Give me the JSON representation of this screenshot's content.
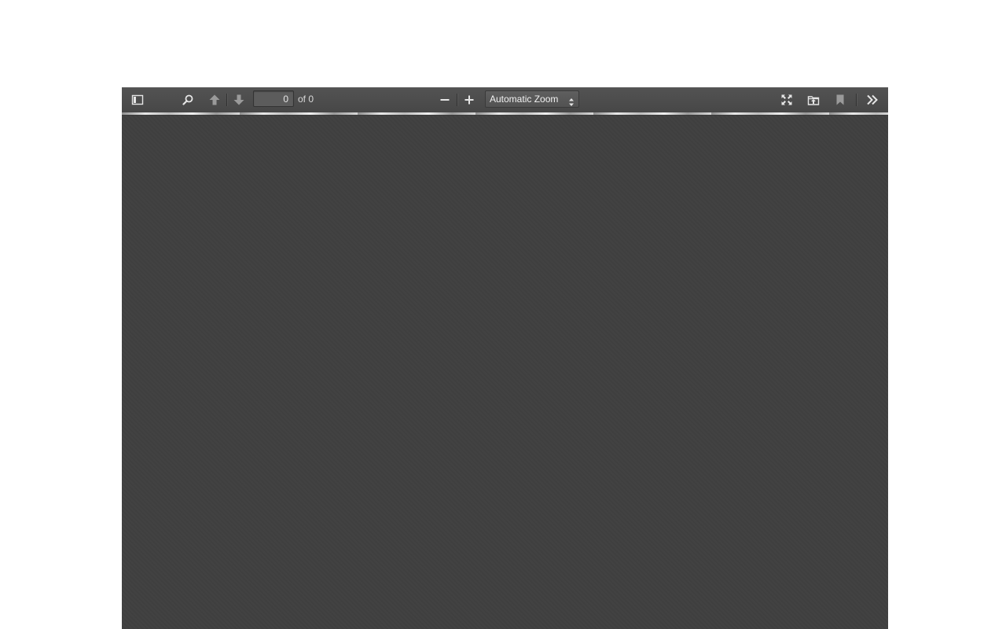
{
  "toolbar": {
    "sidebar_toggle": "sidebar-toggle-icon",
    "find": "search-icon",
    "previous_page": "arrow-up-icon",
    "next_page": "arrow-down-icon",
    "page_number": "0",
    "page_count_label": "of 0",
    "zoom_out": "minus-icon",
    "zoom_in": "plus-icon",
    "zoom_value": "Automatic Zoom",
    "presentation_mode": "fullscreen-icon",
    "open_file": "open-file-icon",
    "bookmark": "bookmark-icon",
    "tools": "double-chevron-right-icon"
  },
  "colors": {
    "toolbar": "#4d4d4d",
    "viewer_background": "#404040",
    "icon": "#e6e6e6",
    "icon_disabled": "#9a9a9a"
  }
}
